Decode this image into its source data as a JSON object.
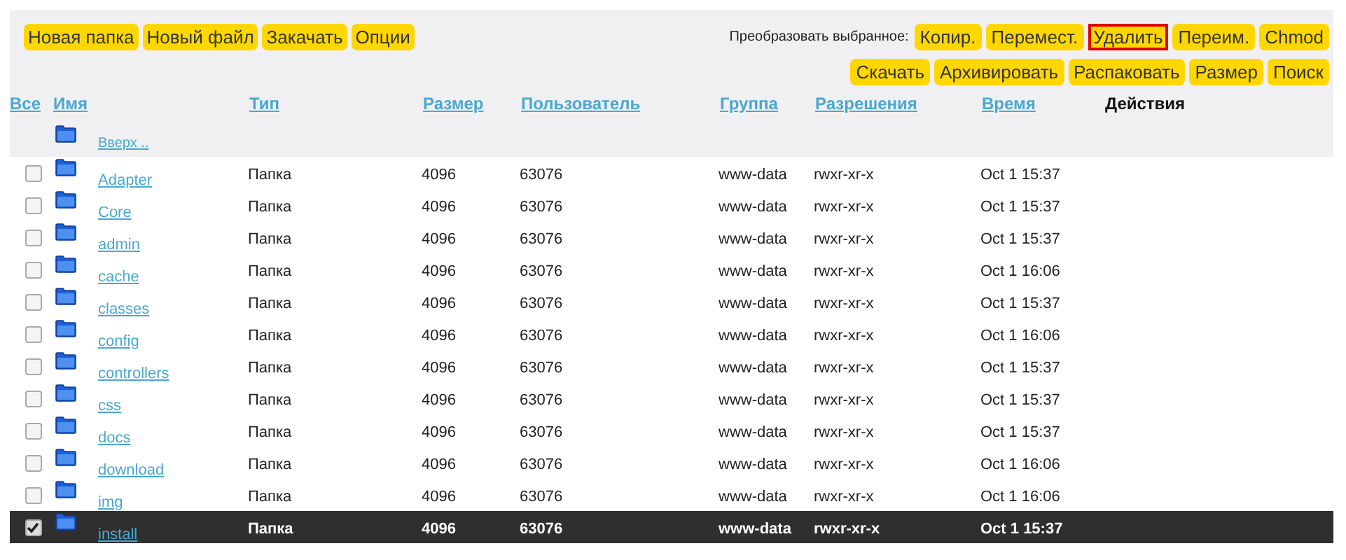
{
  "left_buttons": [
    {
      "label": "Новая папка"
    },
    {
      "label": "Новый файл"
    },
    {
      "label": "Закачать"
    },
    {
      "label": "Опции"
    }
  ],
  "bulk_label": "Преобразовать выбранное:",
  "bulk_buttons_row1": [
    {
      "label": "Копир.",
      "highlighted": false
    },
    {
      "label": "Перемест.",
      "highlighted": false
    },
    {
      "label": "Удалить",
      "highlighted": true
    },
    {
      "label": "Переим.",
      "highlighted": false
    },
    {
      "label": "Chmod",
      "highlighted": false
    }
  ],
  "bulk_buttons_row2": [
    {
      "label": "Скачать",
      "highlighted": false
    },
    {
      "label": "Архивировать",
      "highlighted": false
    },
    {
      "label": "Распаковать",
      "highlighted": false
    },
    {
      "label": "Размер",
      "highlighted": false
    },
    {
      "label": "Поиск",
      "highlighted": false
    }
  ],
  "table": {
    "columns": [
      {
        "label": "Все",
        "kind": "link"
      },
      {
        "label": "Имя",
        "kind": "link"
      },
      {
        "label": "Тип",
        "kind": "link"
      },
      {
        "label": "Размер",
        "kind": "link"
      },
      {
        "label": "Пользователь",
        "kind": "link"
      },
      {
        "label": "Группа",
        "kind": "link"
      },
      {
        "label": "Разрешения",
        "kind": "link"
      },
      {
        "label": "Время",
        "kind": "link"
      },
      {
        "label": "Действия",
        "kind": "plain"
      }
    ],
    "up_link": "Вверх ..",
    "rows": [
      {
        "name": "Adapter",
        "type": "Папка",
        "size": "4096",
        "user": "63076",
        "group": "www-data",
        "perms": "rwxr-xr-x",
        "time": "Oct 1 15:37",
        "selected": false
      },
      {
        "name": "Core",
        "type": "Папка",
        "size": "4096",
        "user": "63076",
        "group": "www-data",
        "perms": "rwxr-xr-x",
        "time": "Oct 1 15:37",
        "selected": false
      },
      {
        "name": "admin",
        "type": "Папка",
        "size": "4096",
        "user": "63076",
        "group": "www-data",
        "perms": "rwxr-xr-x",
        "time": "Oct 1 15:37",
        "selected": false
      },
      {
        "name": "cache",
        "type": "Папка",
        "size": "4096",
        "user": "63076",
        "group": "www-data",
        "perms": "rwxr-xr-x",
        "time": "Oct 1 16:06",
        "selected": false
      },
      {
        "name": "classes",
        "type": "Папка",
        "size": "4096",
        "user": "63076",
        "group": "www-data",
        "perms": "rwxr-xr-x",
        "time": "Oct 1 15:37",
        "selected": false
      },
      {
        "name": "config",
        "type": "Папка",
        "size": "4096",
        "user": "63076",
        "group": "www-data",
        "perms": "rwxr-xr-x",
        "time": "Oct 1 16:06",
        "selected": false
      },
      {
        "name": "controllers",
        "type": "Папка",
        "size": "4096",
        "user": "63076",
        "group": "www-data",
        "perms": "rwxr-xr-x",
        "time": "Oct 1 15:37",
        "selected": false
      },
      {
        "name": "css",
        "type": "Папка",
        "size": "4096",
        "user": "63076",
        "group": "www-data",
        "perms": "rwxr-xr-x",
        "time": "Oct 1 15:37",
        "selected": false
      },
      {
        "name": "docs",
        "type": "Папка",
        "size": "4096",
        "user": "63076",
        "group": "www-data",
        "perms": "rwxr-xr-x",
        "time": "Oct 1 15:37",
        "selected": false
      },
      {
        "name": "download",
        "type": "Папка",
        "size": "4096",
        "user": "63076",
        "group": "www-data",
        "perms": "rwxr-xr-x",
        "time": "Oct 1 16:06",
        "selected": false
      },
      {
        "name": "img",
        "type": "Папка",
        "size": "4096",
        "user": "63076",
        "group": "www-data",
        "perms": "rwxr-xr-x",
        "time": "Oct 1 16:06",
        "selected": false
      },
      {
        "name": "install",
        "type": "Папка",
        "size": "4096",
        "user": "63076",
        "group": "www-data",
        "perms": "rwxr-xr-x",
        "time": "Oct 1 15:37",
        "selected": true
      }
    ]
  }
}
